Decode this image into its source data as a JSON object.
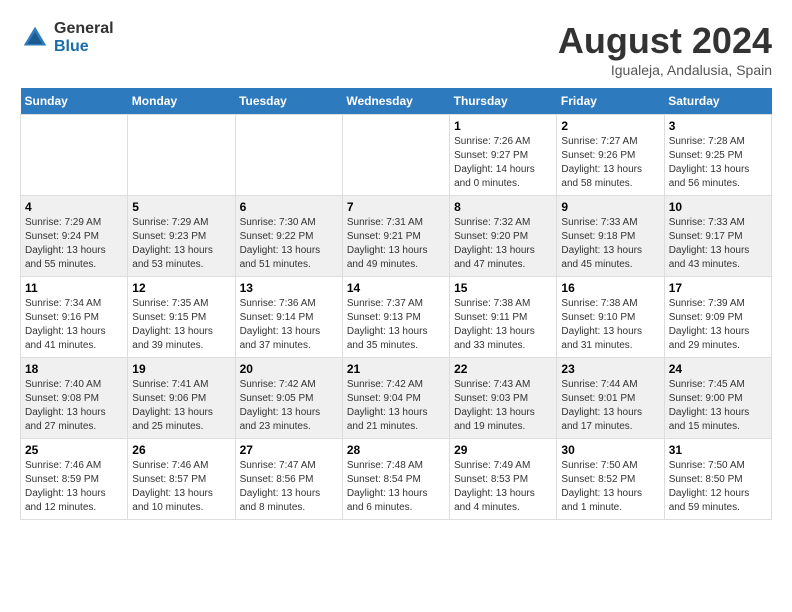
{
  "logo": {
    "general": "General",
    "blue": "Blue"
  },
  "title": {
    "month_year": "August 2024",
    "location": "Igualeja, Andalusia, Spain"
  },
  "days_of_week": [
    "Sunday",
    "Monday",
    "Tuesday",
    "Wednesday",
    "Thursday",
    "Friday",
    "Saturday"
  ],
  "weeks": [
    {
      "days": [
        {
          "num": "",
          "info": ""
        },
        {
          "num": "",
          "info": ""
        },
        {
          "num": "",
          "info": ""
        },
        {
          "num": "",
          "info": ""
        },
        {
          "num": "1",
          "info": "Sunrise: 7:26 AM\nSunset: 9:27 PM\nDaylight: 14 hours\nand 0 minutes."
        },
        {
          "num": "2",
          "info": "Sunrise: 7:27 AM\nSunset: 9:26 PM\nDaylight: 13 hours\nand 58 minutes."
        },
        {
          "num": "3",
          "info": "Sunrise: 7:28 AM\nSunset: 9:25 PM\nDaylight: 13 hours\nand 56 minutes."
        }
      ]
    },
    {
      "days": [
        {
          "num": "4",
          "info": "Sunrise: 7:29 AM\nSunset: 9:24 PM\nDaylight: 13 hours\nand 55 minutes."
        },
        {
          "num": "5",
          "info": "Sunrise: 7:29 AM\nSunset: 9:23 PM\nDaylight: 13 hours\nand 53 minutes."
        },
        {
          "num": "6",
          "info": "Sunrise: 7:30 AM\nSunset: 9:22 PM\nDaylight: 13 hours\nand 51 minutes."
        },
        {
          "num": "7",
          "info": "Sunrise: 7:31 AM\nSunset: 9:21 PM\nDaylight: 13 hours\nand 49 minutes."
        },
        {
          "num": "8",
          "info": "Sunrise: 7:32 AM\nSunset: 9:20 PM\nDaylight: 13 hours\nand 47 minutes."
        },
        {
          "num": "9",
          "info": "Sunrise: 7:33 AM\nSunset: 9:18 PM\nDaylight: 13 hours\nand 45 minutes."
        },
        {
          "num": "10",
          "info": "Sunrise: 7:33 AM\nSunset: 9:17 PM\nDaylight: 13 hours\nand 43 minutes."
        }
      ]
    },
    {
      "days": [
        {
          "num": "11",
          "info": "Sunrise: 7:34 AM\nSunset: 9:16 PM\nDaylight: 13 hours\nand 41 minutes."
        },
        {
          "num": "12",
          "info": "Sunrise: 7:35 AM\nSunset: 9:15 PM\nDaylight: 13 hours\nand 39 minutes."
        },
        {
          "num": "13",
          "info": "Sunrise: 7:36 AM\nSunset: 9:14 PM\nDaylight: 13 hours\nand 37 minutes."
        },
        {
          "num": "14",
          "info": "Sunrise: 7:37 AM\nSunset: 9:13 PM\nDaylight: 13 hours\nand 35 minutes."
        },
        {
          "num": "15",
          "info": "Sunrise: 7:38 AM\nSunset: 9:11 PM\nDaylight: 13 hours\nand 33 minutes."
        },
        {
          "num": "16",
          "info": "Sunrise: 7:38 AM\nSunset: 9:10 PM\nDaylight: 13 hours\nand 31 minutes."
        },
        {
          "num": "17",
          "info": "Sunrise: 7:39 AM\nSunset: 9:09 PM\nDaylight: 13 hours\nand 29 minutes."
        }
      ]
    },
    {
      "days": [
        {
          "num": "18",
          "info": "Sunrise: 7:40 AM\nSunset: 9:08 PM\nDaylight: 13 hours\nand 27 minutes."
        },
        {
          "num": "19",
          "info": "Sunrise: 7:41 AM\nSunset: 9:06 PM\nDaylight: 13 hours\nand 25 minutes."
        },
        {
          "num": "20",
          "info": "Sunrise: 7:42 AM\nSunset: 9:05 PM\nDaylight: 13 hours\nand 23 minutes."
        },
        {
          "num": "21",
          "info": "Sunrise: 7:42 AM\nSunset: 9:04 PM\nDaylight: 13 hours\nand 21 minutes."
        },
        {
          "num": "22",
          "info": "Sunrise: 7:43 AM\nSunset: 9:03 PM\nDaylight: 13 hours\nand 19 minutes."
        },
        {
          "num": "23",
          "info": "Sunrise: 7:44 AM\nSunset: 9:01 PM\nDaylight: 13 hours\nand 17 minutes."
        },
        {
          "num": "24",
          "info": "Sunrise: 7:45 AM\nSunset: 9:00 PM\nDaylight: 13 hours\nand 15 minutes."
        }
      ]
    },
    {
      "days": [
        {
          "num": "25",
          "info": "Sunrise: 7:46 AM\nSunset: 8:59 PM\nDaylight: 13 hours\nand 12 minutes."
        },
        {
          "num": "26",
          "info": "Sunrise: 7:46 AM\nSunset: 8:57 PM\nDaylight: 13 hours\nand 10 minutes."
        },
        {
          "num": "27",
          "info": "Sunrise: 7:47 AM\nSunset: 8:56 PM\nDaylight: 13 hours\nand 8 minutes."
        },
        {
          "num": "28",
          "info": "Sunrise: 7:48 AM\nSunset: 8:54 PM\nDaylight: 13 hours\nand 6 minutes."
        },
        {
          "num": "29",
          "info": "Sunrise: 7:49 AM\nSunset: 8:53 PM\nDaylight: 13 hours\nand 4 minutes."
        },
        {
          "num": "30",
          "info": "Sunrise: 7:50 AM\nSunset: 8:52 PM\nDaylight: 13 hours\nand 1 minute."
        },
        {
          "num": "31",
          "info": "Sunrise: 7:50 AM\nSunset: 8:50 PM\nDaylight: 12 hours\nand 59 minutes."
        }
      ]
    }
  ]
}
